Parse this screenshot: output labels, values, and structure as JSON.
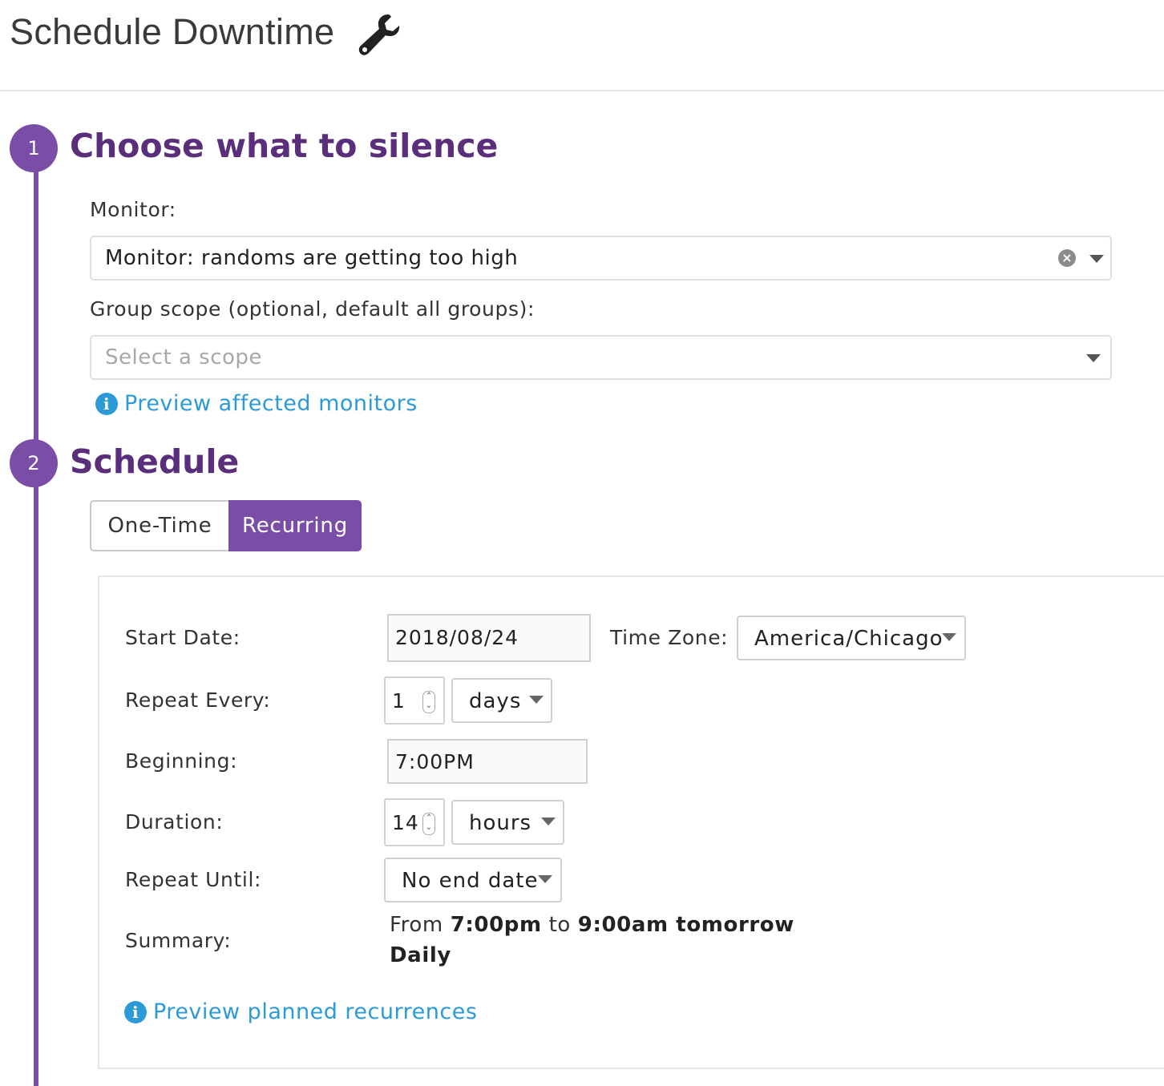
{
  "header": {
    "title": "Schedule Downtime",
    "icon": "wrench-icon"
  },
  "step1": {
    "number": "1",
    "title": "Choose what to silence",
    "monitor_label": "Monitor:",
    "monitor_value": "Monitor: randoms are getting too high",
    "scope_label": "Group scope (optional, default all groups):",
    "scope_placeholder": "Select a scope",
    "preview_link": "Preview affected monitors"
  },
  "step2": {
    "number": "2",
    "title": "Schedule",
    "tabs": [
      {
        "label": "One-Time",
        "active": false
      },
      {
        "label": "Recurring",
        "active": true
      }
    ],
    "form": {
      "start_date_label": "Start Date:",
      "start_date_value": "2018/08/24",
      "timezone_label": "Time Zone:",
      "timezone_value": "America/Chicago",
      "repeat_every_label": "Repeat Every:",
      "repeat_every_value": "1",
      "repeat_every_unit": "days",
      "beginning_label": "Beginning:",
      "beginning_value": "7:00PM",
      "duration_label": "Duration:",
      "duration_value": "14",
      "duration_unit": "hours",
      "repeat_until_label": "Repeat Until:",
      "repeat_until_value": "No end date",
      "summary_label": "Summary:",
      "summary": {
        "from": "From",
        "start": "7:00pm",
        "to": "to",
        "end": "9:00am tomorrow",
        "frequency": "Daily"
      },
      "preview_link": "Preview planned recurrences"
    }
  },
  "colors": {
    "accent": "#7a4ea6",
    "title": "#5a2e7a",
    "link": "#2b9ad6"
  }
}
